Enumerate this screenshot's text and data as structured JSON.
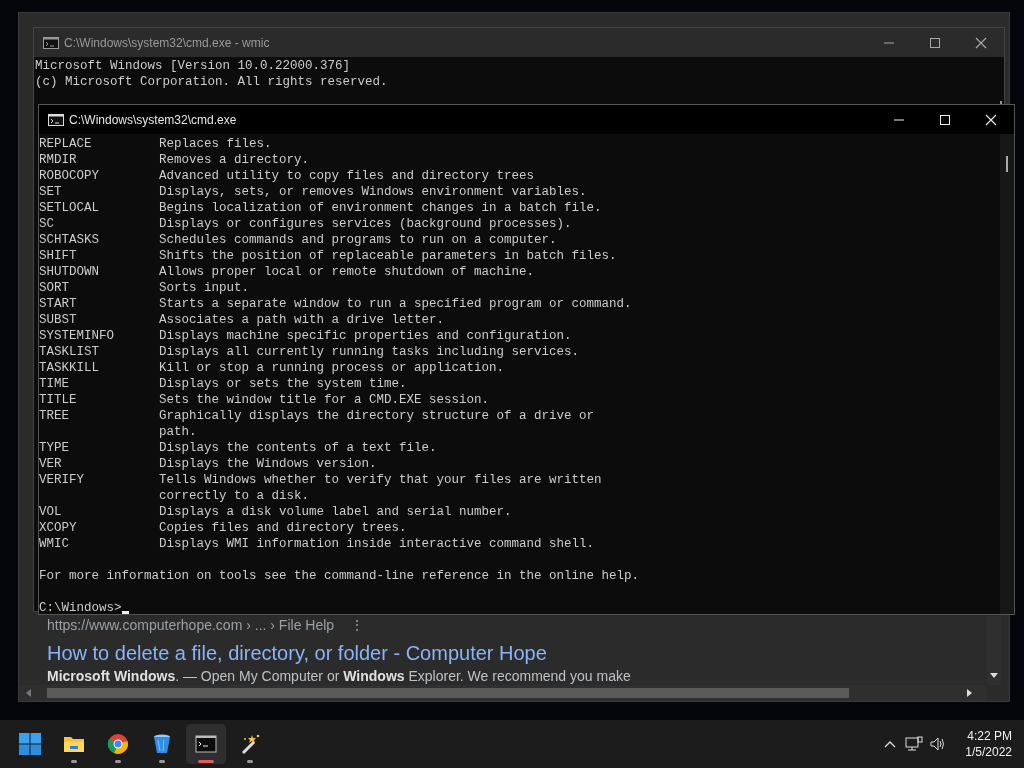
{
  "browser": {
    "result": {
      "url": "https://www.computerhope.com › ... › File Help",
      "menu": "⋮",
      "title": "How to delete a file, directory, or folder - Computer Hope",
      "snippet": "**Microsoft Windows**. — Open My Computer or **Windows** Explorer. We recommend you make"
    }
  },
  "back_window": {
    "title": "C:\\Windows\\system32\\cmd.exe - wmic",
    "lines": [
      "Microsoft Windows [Version 10.0.22000.376]",
      "(c) Microsoft Corporation. All rights reserved."
    ]
  },
  "front_window": {
    "title": "C:\\Windows\\system32\\cmd.exe",
    "commands": [
      {
        "name": "REPLACE",
        "description": "Replaces files."
      },
      {
        "name": "RMDIR",
        "description": "Removes a directory."
      },
      {
        "name": "ROBOCOPY",
        "description": "Advanced utility to copy files and directory trees"
      },
      {
        "name": "SET",
        "description": "Displays, sets, or removes Windows environment variables."
      },
      {
        "name": "SETLOCAL",
        "description": "Begins localization of environment changes in a batch file."
      },
      {
        "name": "SC",
        "description": "Displays or configures services (background processes)."
      },
      {
        "name": "SCHTASKS",
        "description": "Schedules commands and programs to run on a computer."
      },
      {
        "name": "SHIFT",
        "description": "Shifts the position of replaceable parameters in batch files."
      },
      {
        "name": "SHUTDOWN",
        "description": "Allows proper local or remote shutdown of machine."
      },
      {
        "name": "SORT",
        "description": "Sorts input."
      },
      {
        "name": "START",
        "description": "Starts a separate window to run a specified program or command."
      },
      {
        "name": "SUBST",
        "description": "Associates a path with a drive letter."
      },
      {
        "name": "SYSTEMINFO",
        "description": "Displays machine specific properties and configuration."
      },
      {
        "name": "TASKLIST",
        "description": "Displays all currently running tasks including services."
      },
      {
        "name": "TASKKILL",
        "description": "Kill or stop a running process or application."
      },
      {
        "name": "TIME",
        "description": "Displays or sets the system time."
      },
      {
        "name": "TITLE",
        "description": "Sets the window title for a CMD.EXE session."
      },
      {
        "name": "TREE",
        "description": "Graphically displays the directory structure of a drive or\npath."
      },
      {
        "name": "TYPE",
        "description": "Displays the contents of a text file."
      },
      {
        "name": "VER",
        "description": "Displays the Windows version."
      },
      {
        "name": "VERIFY",
        "description": "Tells Windows whether to verify that your files are written\ncorrectly to a disk."
      },
      {
        "name": "VOL",
        "description": "Displays a disk volume label and serial number."
      },
      {
        "name": "XCOPY",
        "description": "Copies files and directory trees."
      },
      {
        "name": "WMIC",
        "description": "Displays WMI information inside interactive command shell."
      }
    ],
    "footer": "For more information on tools see the command-line reference in the online help.",
    "prompt": "C:\\Windows>"
  },
  "taskbar": {
    "apps": [
      {
        "kind": "start",
        "running": false,
        "active": false
      },
      {
        "kind": "folder",
        "running": true,
        "active": false
      },
      {
        "kind": "chrome",
        "running": true,
        "active": false
      },
      {
        "kind": "bin",
        "running": true,
        "active": false
      },
      {
        "kind": "terminal",
        "running": true,
        "active": true
      },
      {
        "kind": "wand",
        "running": true,
        "active": false
      }
    ],
    "clock": {
      "time": "4:22 PM",
      "date": "1/5/2022"
    }
  }
}
